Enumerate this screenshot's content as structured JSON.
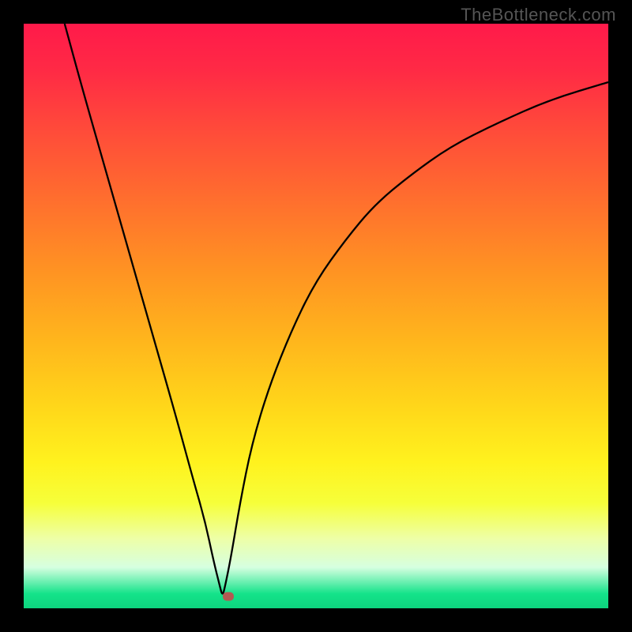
{
  "watermark": "TheBottleneck.com",
  "chart_data": {
    "type": "line",
    "title": "",
    "xlabel": "",
    "ylabel": "",
    "xlim": [
      0,
      100
    ],
    "ylim": [
      0,
      100
    ],
    "series": [
      {
        "name": "curve",
        "x": [
          7,
          10,
          14,
          18,
          22,
          26,
          29,
          31,
          32.5,
          33.5,
          34,
          34.5,
          35.5,
          37,
          39,
          42,
          46,
          50,
          55,
          60,
          66,
          73,
          81,
          90,
          100
        ],
        "y": [
          100,
          89,
          75,
          61,
          47,
          33,
          22,
          15,
          8,
          4,
          2,
          4,
          9,
          18,
          28,
          38,
          48,
          56,
          63,
          69,
          74,
          79,
          83,
          87,
          90
        ]
      }
    ],
    "marker": {
      "x": 35,
      "y": 2
    },
    "gradient_colors": {
      "top": "#ff1a4a",
      "mid": "#ffd81a",
      "bottom": "#0dd47e"
    }
  }
}
